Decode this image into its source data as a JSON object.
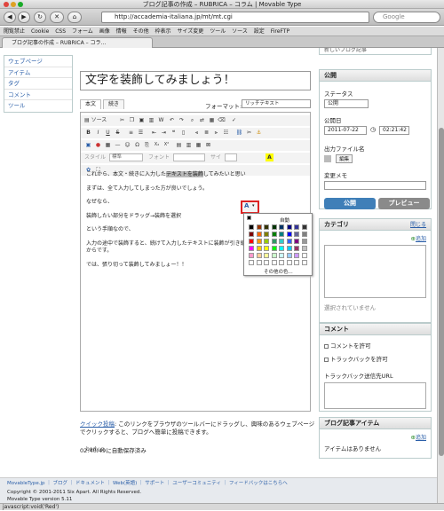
{
  "window": {
    "title": "ブログ記事の作成 – RUBRICA – コラム | Movable Type"
  },
  "nav": {
    "back": "◀",
    "forward": "▶",
    "reload": "↻",
    "home": "⌂",
    "url": "http://accademia-italiana.jp/mt/mt.cgi",
    "search_placeholder": "Google"
  },
  "bookmarks": [
    "閲覧禁止",
    "Cookie",
    "CSS",
    "フォーム",
    "画像",
    "情報",
    "その他",
    "枠表示",
    "サイズ変更",
    "ツール",
    "ソース",
    "設定",
    "FireFTP"
  ],
  "tab": {
    "label": "ブログ記事の作成 – RUBRICA – コラ…"
  },
  "sidebar": {
    "items": [
      "ウェブページ",
      "アイテム",
      "タグ",
      "コメント",
      "ツール"
    ]
  },
  "entry": {
    "title": "文字を装飾してみましょう！",
    "tabs": [
      "本文",
      "続き"
    ],
    "format_label": "フォーマット:",
    "format_value": "リッチテキスト",
    "toolbar": {
      "source": "ソース",
      "style": "スタイル",
      "style_value": "標準",
      "font": "フォント",
      "size": "サイ"
    },
    "body": {
      "p1_pre": "これから、本文・続きに入力した",
      "p1_hl": "テキストを装飾",
      "p1_post": "してみたいと思い",
      "p2": "まずは、全て入力してしまった方が良いでしょう。",
      "p3": "なぜなら、",
      "p4": "装飾したい部分をドラッグ→装飾を選択",
      "p5": "という手順なので、",
      "p6": "入力の途中で装飾すると、続けて入力したテキストに装飾が引き継がれてしまうことがあるからです。",
      "p7": "では、張り切って装飾してみましょー！！"
    },
    "path": "body  p"
  },
  "colorpicker": {
    "auto_label": "自動",
    "more_label": "その他の色..."
  },
  "quickpost": {
    "link": "クイック投稿",
    "text": ": このリンクをブラウザのツールバーにドラッグし、興味のあるウェブページでクリックすると、ブログへ簡単に投稿できます。"
  },
  "autosave": "02:40:49に自動保存済み",
  "publish": {
    "top_title": "新しいブログ記事",
    "title": "公開",
    "status_label": "ステータス",
    "status_value": "公開",
    "date_label": "公開日",
    "date_value": "2011-07-22",
    "time_value": "02:21:42",
    "filename_label": "出力ファイル名",
    "edit_btn": "編集",
    "memo_label": "変更メモ",
    "publish_btn": "公開",
    "preview_btn": "プレビュー"
  },
  "category": {
    "title": "カテゴリ",
    "close": "閉じる",
    "add": "追加",
    "empty": "選択されていません"
  },
  "comments": {
    "title": "コメント",
    "allow_comments": "コメントを許可",
    "allow_trackbacks": "トラックバックを許可",
    "trackback_url_label": "トラックバック送信先URL"
  },
  "items": {
    "title": "ブログ記事アイテム",
    "add": "追加",
    "empty": "アイテムはありません"
  },
  "footer": {
    "links": "MovableType.jp ｜ ブログ ｜ ドキュメント ｜ Web(英語) ｜ サポート ｜ ユーザーコミュニティ ｜ フィードバックはこちらへ",
    "copyright": "Copyright © 2001-2011 Six Apart. All Rights Reserved.",
    "version": "Movable Type version 5.11"
  },
  "status": "javascript:void('Red')",
  "colors": {
    "swatches": [
      "#000000",
      "#993300",
      "#333300",
      "#003300",
      "#003366",
      "#000080",
      "#333399",
      "#333333",
      "#800000",
      "#ff6600",
      "#808000",
      "#008000",
      "#008080",
      "#0000ff",
      "#666699",
      "#808080",
      "#ff0000",
      "#ff9900",
      "#99cc00",
      "#339966",
      "#33cccc",
      "#3366ff",
      "#800080",
      "#999999",
      "#ff00ff",
      "#ffcc00",
      "#ffff00",
      "#00ff00",
      "#00ffff",
      "#00ccff",
      "#993366",
      "#c0c0c0",
      "#ff99cc",
      "#ffcc99",
      "#ffff99",
      "#ccffcc",
      "#ccffff",
      "#99ccff",
      "#cc99ff",
      "#ffffff",
      "#ffffff",
      "#ffffff",
      "#ffffff",
      "#ffffff",
      "#ffffff",
      "#ffffff",
      "#ffffff",
      "#ffffff"
    ]
  }
}
